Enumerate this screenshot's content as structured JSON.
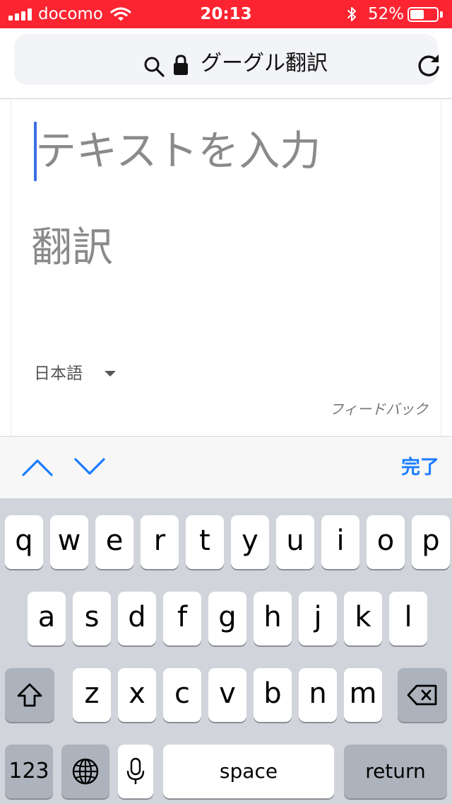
{
  "status": {
    "carrier": "docomo",
    "time": "20:13",
    "battery": "52%",
    "battery_level": 0.52
  },
  "browser": {
    "url_text": "グーグル翻訳",
    "icons": [
      "search-icon",
      "lock-icon",
      "reload-icon"
    ]
  },
  "translate": {
    "input_placeholder": "テキストを入力",
    "output_placeholder": "翻訳",
    "target_language": "日本語",
    "feedback": "フィードバック"
  },
  "accessory": {
    "done": "完了"
  },
  "keyboard": {
    "row1": [
      "q",
      "w",
      "e",
      "r",
      "t",
      "y",
      "u",
      "i",
      "o",
      "p"
    ],
    "row2": [
      "a",
      "s",
      "d",
      "f",
      "g",
      "h",
      "j",
      "k",
      "l"
    ],
    "row3": [
      "z",
      "x",
      "c",
      "v",
      "b",
      "n",
      "m"
    ],
    "numbers": "123",
    "space": "space",
    "return": "return"
  },
  "colors": {
    "status_bar": "#fc2431",
    "caret": "#3a6ee8",
    "accent": "#1a7cff"
  }
}
